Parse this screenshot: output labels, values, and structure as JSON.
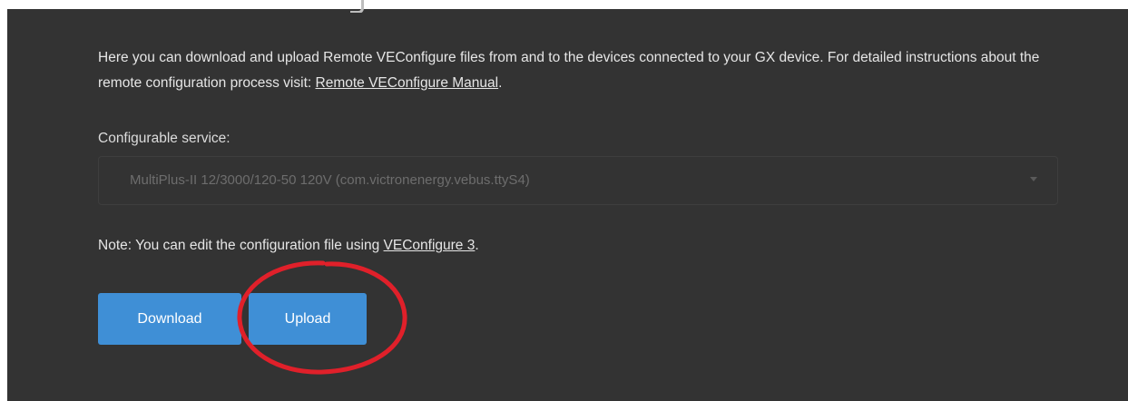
{
  "description": {
    "text_before_link": "Here you can download and upload Remote VEConfigure files from and to the devices connected to your GX device. For detailed instructions about the remote configuration process visit: ",
    "link_text": "Remote VEConfigure Manual",
    "text_after_link": "."
  },
  "service": {
    "label": "Configurable service:",
    "selected": "MultiPlus-II 12/3000/120-50 120V (com.victronenergy.vebus.ttyS4)"
  },
  "note": {
    "text_before_link": "Note: You can edit the configuration file using ",
    "link_text": "VEConfigure 3",
    "text_after_link": "."
  },
  "actions": {
    "download_label": "Download",
    "upload_label": "Upload"
  },
  "colors": {
    "panel_background": "#333333",
    "button_blue": "#3f8fd6",
    "annotation_red": "#e0202a"
  }
}
